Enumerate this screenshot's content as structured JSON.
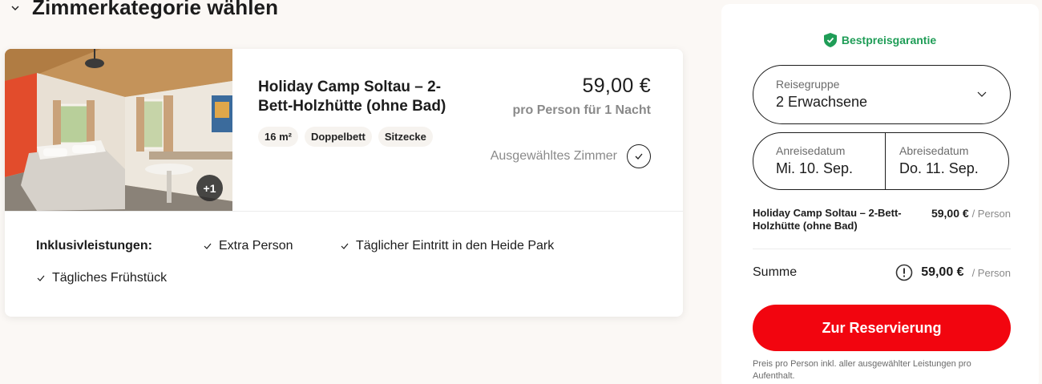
{
  "section": {
    "title": "Zimmerkategorie wählen"
  },
  "room": {
    "photo_more_count": "+1",
    "title": "Holiday Camp Soltau – 2-Bett-Holzhütte (ohne Bad)",
    "tags": [
      "16 m²",
      "Doppelbett",
      "Sitzecke"
    ],
    "price": "59,00 €",
    "price_caption": "pro Person für 1 Nacht",
    "selected_label": "Ausgewähltes Zimmer",
    "inclusives_label": "Inklusivleistungen:",
    "inclusives": [
      "Extra Person",
      "Täglicher Eintritt in den Heide Park",
      "Tägliches Frühstück"
    ]
  },
  "sidebar": {
    "guarantee": "Bestpreisgarantie",
    "group_label": "Reisegruppe",
    "group_value": "2 Erwachsene",
    "arrival_label": "Anreisedatum",
    "arrival_value": "Mi. 10. Sep.",
    "departure_label": "Abreisedatum",
    "departure_value": "Do. 11. Sep.",
    "summary_room": "Holiday Camp Soltau – 2-Bett-Holzhütte (ohne Bad)",
    "summary_room_price": "59,00 €",
    "per_person": "/ Person",
    "total_label": "Summe",
    "total_price": "59,00 €",
    "reserve_button": "Zur Reservierung",
    "footnote": "Preis pro Person inkl. aller ausgewählter Leistungen pro Aufenthalt."
  },
  "colors": {
    "accent_red": "#f2050f",
    "guarantee_green": "#1f9d57",
    "background": "#fbf8f5"
  },
  "icons": [
    "chevron-down-icon",
    "check-icon",
    "shield-check-icon",
    "info-icon"
  ]
}
